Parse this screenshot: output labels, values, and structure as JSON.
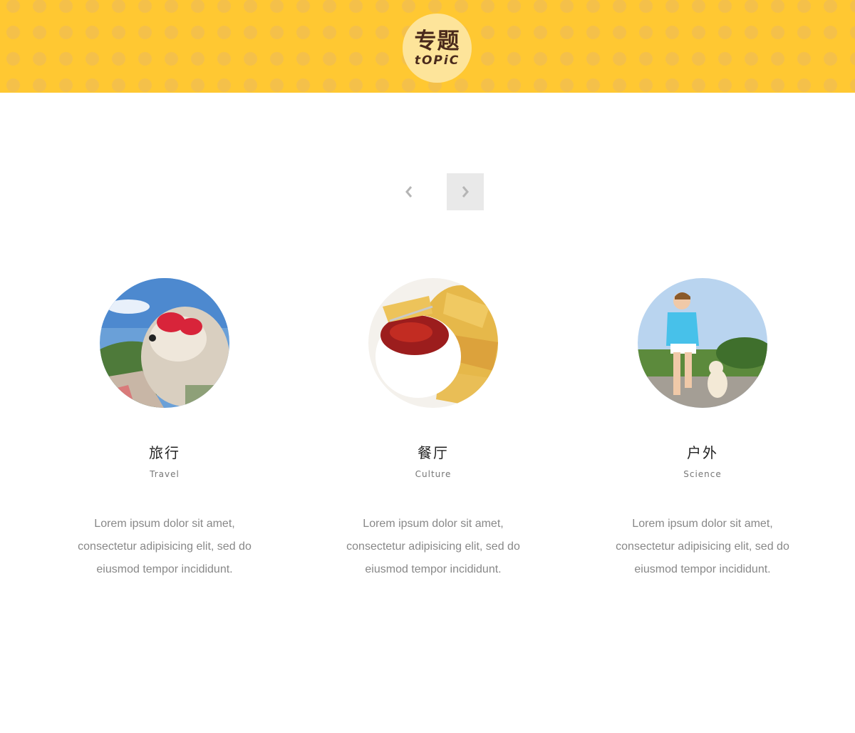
{
  "header": {
    "badge_cn": "专题",
    "badge_en": "tOPiC",
    "background_color": "#ffc832",
    "badge_color": "#fde49a"
  },
  "carousel": {
    "prev_icon": "chevron-left-icon",
    "next_icon": "chevron-right-icon"
  },
  "topics": [
    {
      "image": "dog-with-goggles-photo",
      "title": "旅行",
      "subtitle": "Travel",
      "description": "Lorem ipsum dolor sit amet, consectetur adipisicing elit, sed do eiusmod tempor incididunt."
    },
    {
      "image": "potato-wedges-ketchup-photo",
      "title": "餐厅",
      "subtitle": "Culture",
      "description": "Lorem ipsum dolor sit amet, consectetur adipisicing elit, sed do eiusmod tempor incididunt."
    },
    {
      "image": "woman-running-with-dog-photo",
      "title": "户外",
      "subtitle": "Science",
      "description": "Lorem ipsum dolor sit amet, consectetur adipisicing elit, sed do eiusmod tempor incididunt."
    }
  ]
}
